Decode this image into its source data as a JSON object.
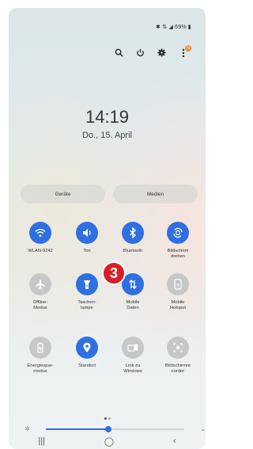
{
  "status_bar": {
    "text": "✱ ⇅ ◢ 69% ▮"
  },
  "header_icons": [
    "search-icon",
    "power-icon",
    "gear-icon",
    "more-options-icon"
  ],
  "notification_badge": "N",
  "clock": {
    "time": "14:19",
    "date": "Do., 15. April"
  },
  "buttons": {
    "devices": "Geräte",
    "media": "Medien"
  },
  "tiles": [
    {
      "label": "WLAN-9242",
      "icon": "wifi-icon",
      "active": true
    },
    {
      "label": "Ton",
      "icon": "sound-icon",
      "active": true
    },
    {
      "label": "Bluetooth",
      "icon": "bluetooth-icon",
      "active": true
    },
    {
      "label": "Bildschirm\ndrehen",
      "icon": "auto-rotate-icon",
      "active": true
    },
    {
      "label": "Offline-\nModus",
      "icon": "airplane-icon",
      "active": false
    },
    {
      "label": "Taschen-\nlampe",
      "icon": "flashlight-icon",
      "active": true
    },
    {
      "label": "Mobile\nDaten",
      "icon": "mobile-data-icon",
      "active": true
    },
    {
      "label": "Mobile\nHotspot",
      "icon": "hotspot-icon",
      "active": false
    },
    {
      "label": "Energiespar-\nmodus",
      "icon": "battery-saver-icon",
      "active": false
    },
    {
      "label": "Standort",
      "icon": "location-icon",
      "active": true
    },
    {
      "label": "Link zu\nWindows",
      "icon": "link-windows-icon",
      "active": false
    },
    {
      "label": "Bildschirmre\ncorder",
      "icon": "screen-recorder-icon",
      "active": false
    }
  ],
  "step_badge": "3",
  "brightness": {
    "level": 0.45
  },
  "colors": {
    "accent": "#2f6fe0",
    "inactive": "#c6c8c8",
    "badge": "#d61f26"
  }
}
